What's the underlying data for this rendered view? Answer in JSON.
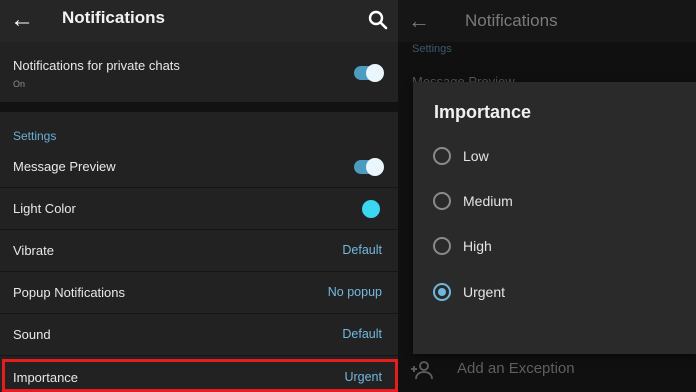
{
  "left": {
    "appbar": {
      "title": "Notifications",
      "back_icon": "arrow-left-icon",
      "search_icon": "search-icon"
    },
    "private_chats": {
      "label": "Notifications for private chats",
      "status": "On",
      "toggle_on": true
    },
    "settings": {
      "header": "Settings",
      "rows": [
        {
          "label": "Message Preview",
          "type": "toggle",
          "on": true
        },
        {
          "label": "Light Color",
          "type": "color",
          "color": "#3bd6f0"
        },
        {
          "label": "Vibrate",
          "type": "value",
          "value": "Default"
        },
        {
          "label": "Popup Notifications",
          "type": "value",
          "value": "No popup"
        },
        {
          "label": "Sound",
          "type": "value",
          "value": "Default"
        },
        {
          "label": "Importance",
          "type": "value",
          "value": "Urgent",
          "highlighted": true
        }
      ]
    }
  },
  "right": {
    "appbar": {
      "title": "Notifications",
      "back_icon": "arrow-left-icon"
    },
    "background_partial": {
      "section_header": "Settings",
      "row_label": "Message Preview"
    },
    "add_exception": {
      "label": "Add an Exception",
      "icon": "add-person-icon"
    },
    "dialog": {
      "title": "Importance",
      "options": [
        {
          "label": "Low",
          "selected": false
        },
        {
          "label": "Medium",
          "selected": false
        },
        {
          "label": "High",
          "selected": false
        },
        {
          "label": "Urgent",
          "selected": true
        }
      ]
    }
  },
  "colors": {
    "accent": "#6fb8de",
    "highlight_border": "#e81c1c",
    "light_color_dot": "#3bd6f0"
  }
}
